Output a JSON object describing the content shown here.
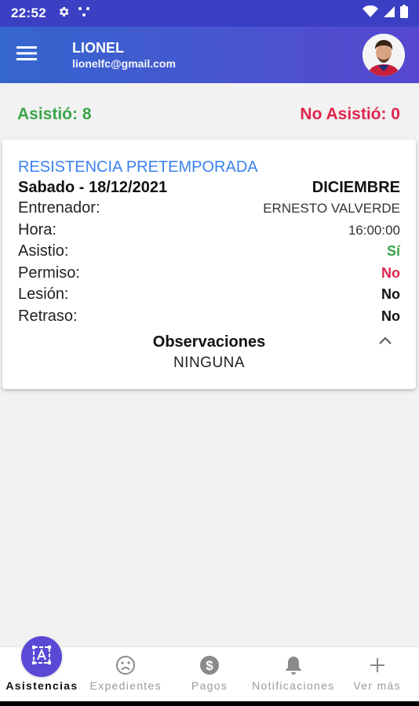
{
  "status_bar": {
    "time": "22:52"
  },
  "header": {
    "user_name": "LIONEL",
    "user_email": "lionelfc@gmail.com"
  },
  "stats": {
    "attended": "Asistió: 8",
    "not_attended": "No Asistió: 0"
  },
  "card": {
    "title": "RESISTENCIA PRETEMPORADA",
    "date": "Sabado - 18/12/2021",
    "month": "DICIEMBRE",
    "fields": [
      {
        "label": "Entrenador:",
        "value": "ERNESTO VALVERDE"
      },
      {
        "label": "Hora:",
        "value": "16:00:00"
      },
      {
        "label": "Asistio:",
        "value": "Sí"
      },
      {
        "label": "Permiso:",
        "value": "No"
      },
      {
        "label": "Lesión:",
        "value": "No"
      },
      {
        "label": "Retraso:",
        "value": "No"
      }
    ],
    "observations_title": "Observaciones",
    "observations_text": "NINGUNA"
  },
  "bottom_nav": [
    {
      "label": "Asistencias",
      "icon": "attendance-icon",
      "active": true
    },
    {
      "label": "Expedientes",
      "icon": "sad-face-icon",
      "active": false
    },
    {
      "label": "Pagos",
      "icon": "dollar-icon",
      "active": false
    },
    {
      "label": "Notificaciones",
      "icon": "bell-icon",
      "active": false
    },
    {
      "label": "Ver más",
      "icon": "plus-icon",
      "active": false
    }
  ],
  "colors": {
    "primary": "#3b3fc4",
    "accent_blue": "#3b82f0",
    "success": "#3aa54a",
    "danger": "#e0244e",
    "active_bubble": "#5b49d6"
  }
}
